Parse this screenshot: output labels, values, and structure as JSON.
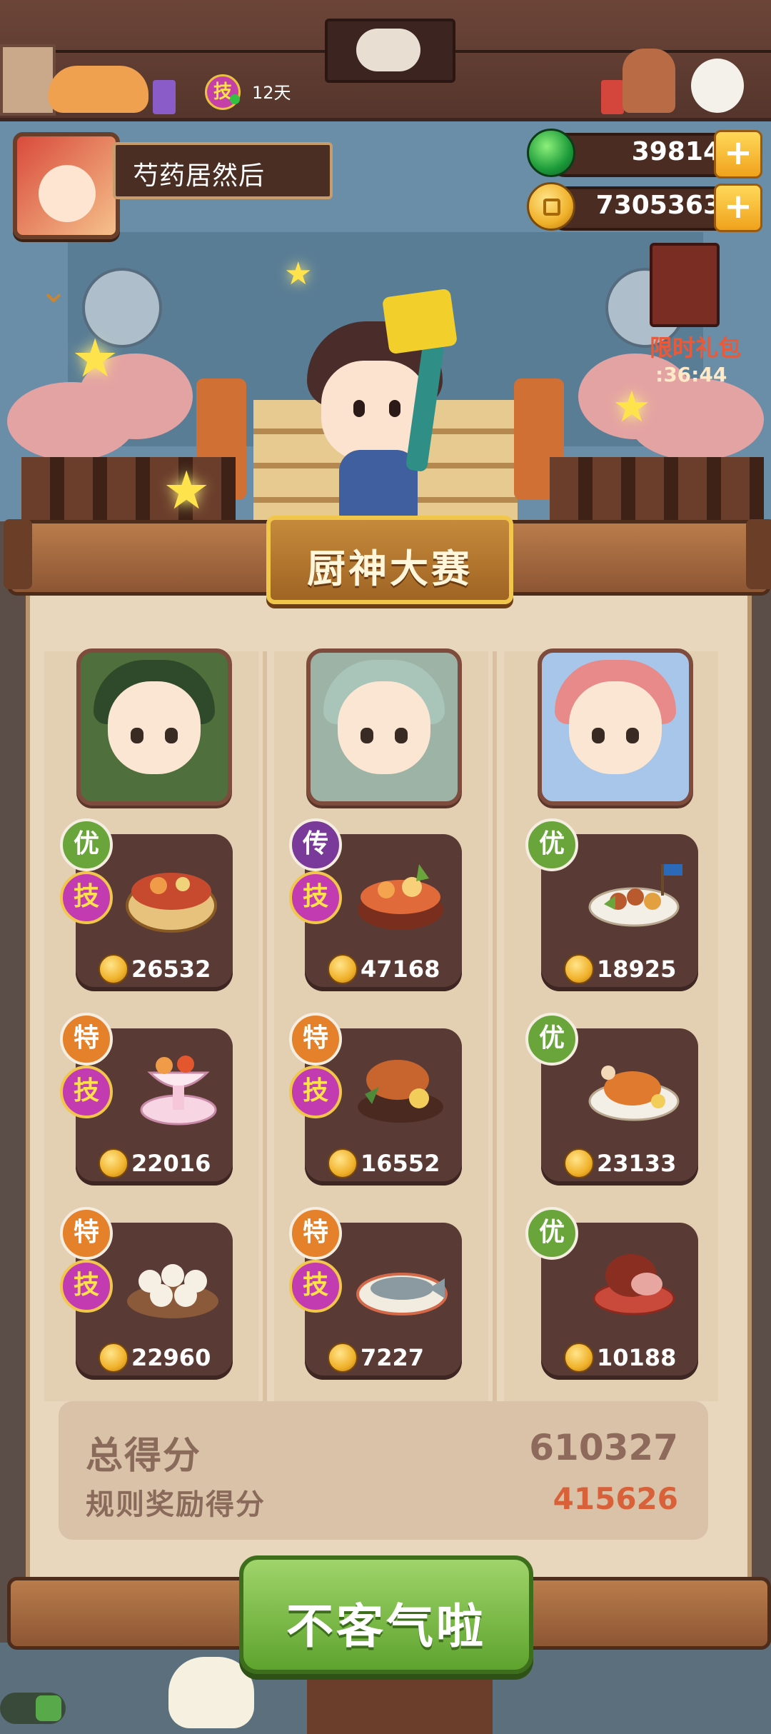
{
  "player": {
    "name": "芍药居然后",
    "skill_badge": "技",
    "days": "12天"
  },
  "currency": {
    "jade": "39814",
    "coins": "7305363",
    "plus": "+"
  },
  "promo": {
    "label": "限时礼包",
    "timer": ":36:44"
  },
  "contest": {
    "title": "厨神大赛",
    "chefs": [
      {
        "name": "chef-1"
      },
      {
        "name": "chef-2"
      },
      {
        "name": "chef-3"
      }
    ],
    "dishes": [
      [
        {
          "grade": "优",
          "skill": "技",
          "score": "26532"
        },
        {
          "grade": "特",
          "skill": "技",
          "score": "22016"
        },
        {
          "grade": "特",
          "skill": "技",
          "score": "22960"
        }
      ],
      [
        {
          "grade": "传",
          "skill": "技",
          "score": "47168"
        },
        {
          "grade": "特",
          "skill": "技",
          "score": "16552"
        },
        {
          "grade": "特",
          "skill": "技",
          "score": "7227"
        }
      ],
      [
        {
          "grade": "优",
          "skill": "",
          "score": "18925"
        },
        {
          "grade": "优",
          "skill": "",
          "score": "23133"
        },
        {
          "grade": "优",
          "skill": "",
          "score": "10188"
        }
      ]
    ],
    "total_label": "总得分",
    "total_score": "610327",
    "bonus_label": "规则奖励得分",
    "bonus_score": "415626",
    "confirm_label": "不客气啦"
  },
  "colors": {
    "grade_you": "#6aa53b",
    "grade_te": "#e4812a",
    "grade_chuan": "#7a3a9a",
    "bonus_score": "#d8613a",
    "confirm_green": "#5ea32e"
  }
}
